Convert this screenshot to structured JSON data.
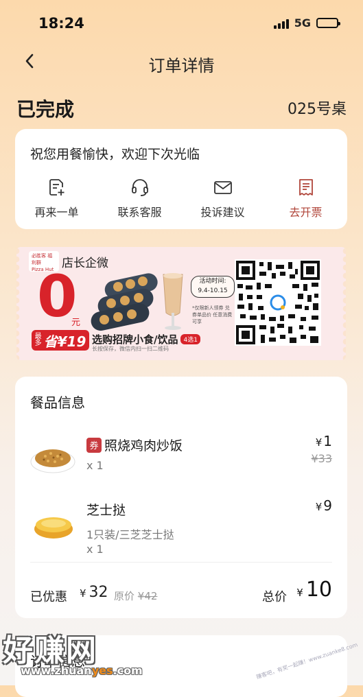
{
  "status_bar": {
    "time": "18:24",
    "network": "5G"
  },
  "nav": {
    "title": "订单详情"
  },
  "order": {
    "status": "已完成",
    "table": "025号桌"
  },
  "greeting": "祝您用餐愉快，欢迎下次光临",
  "actions": [
    {
      "label": "再来一单",
      "icon": "reorder-icon"
    },
    {
      "label": "联系客服",
      "icon": "headset-icon"
    },
    {
      "label": "投诉建议",
      "icon": "mail-icon"
    },
    {
      "label": "去开票",
      "icon": "invoice-icon"
    }
  ],
  "banner": {
    "title": "店长企微",
    "zero": "0",
    "yuan": "元",
    "save_prefix": "最多",
    "save": "省¥19",
    "promo": "选购招牌小食/饮品",
    "promo_tag": "4选1",
    "tip": "长按保存，微信内扫一扫二维码",
    "date_label": "活动时间:",
    "date": "9.4-10.15",
    "note": "*仅限新人领券 兑券单品价 任意消费可享",
    "logo_text": "必胜客 福利群",
    "brand": "Pizza Hut"
  },
  "items_section": {
    "title": "餐品信息",
    "items": [
      {
        "name": "照烧鸡肉炒饭",
        "coupon": "券",
        "qty": "x 1",
        "price": "1",
        "original": "¥33"
      },
      {
        "name": "芝士挞",
        "spec": "1只装/三芝芝士挞",
        "qty": "x 1",
        "price": "9"
      }
    ],
    "currency": "¥",
    "discount_label": "已优惠",
    "discount": "32",
    "orig_label": "原价",
    "orig_value": "¥42",
    "total_label": "总价",
    "total": "10"
  },
  "order_section": {
    "title": "订单信息"
  },
  "watermark": {
    "text": "好赚网",
    "url_pre": "www.zhuan",
    "url_mid": "yes",
    "url_post": ".com",
    "right_text": "赚客吧，有奖一起赚！www.zuanke8.com"
  },
  "colors": {
    "accent": "#d8232a",
    "invoice": "#b0453a",
    "bg_top": "#fcd9ac"
  }
}
